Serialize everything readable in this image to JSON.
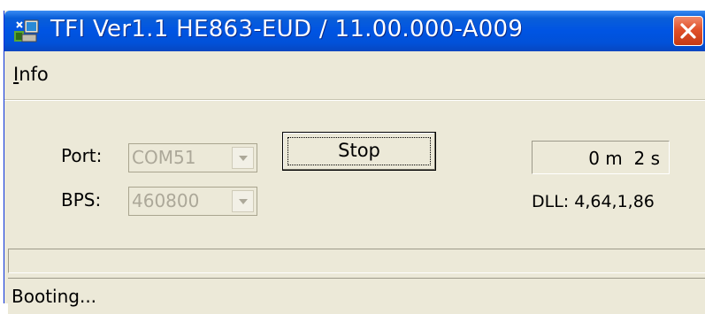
{
  "window": {
    "title": "TFI Ver1.1  HE863-EUD / 11.00.000-A009",
    "app_icon": "tfi-app-icon",
    "close_icon": "close-x-icon"
  },
  "menu": {
    "items": [
      {
        "label": "Info",
        "mnemonic": "I"
      }
    ]
  },
  "controls": {
    "port_label": "Port:",
    "port_value": "COM51",
    "bps_label": "BPS:",
    "bps_value": "460800",
    "stop_label": "Stop",
    "elapsed": "0 m  2 s",
    "dll": "DLL: 4,64,1,86"
  },
  "progress": {
    "value": 0
  },
  "status": {
    "text": "Booting..."
  },
  "colors": {
    "titlebar": "#0054e3",
    "close_button": "#e0502a",
    "window_face": "#ece9d8",
    "disabled_text": "#aca899"
  }
}
